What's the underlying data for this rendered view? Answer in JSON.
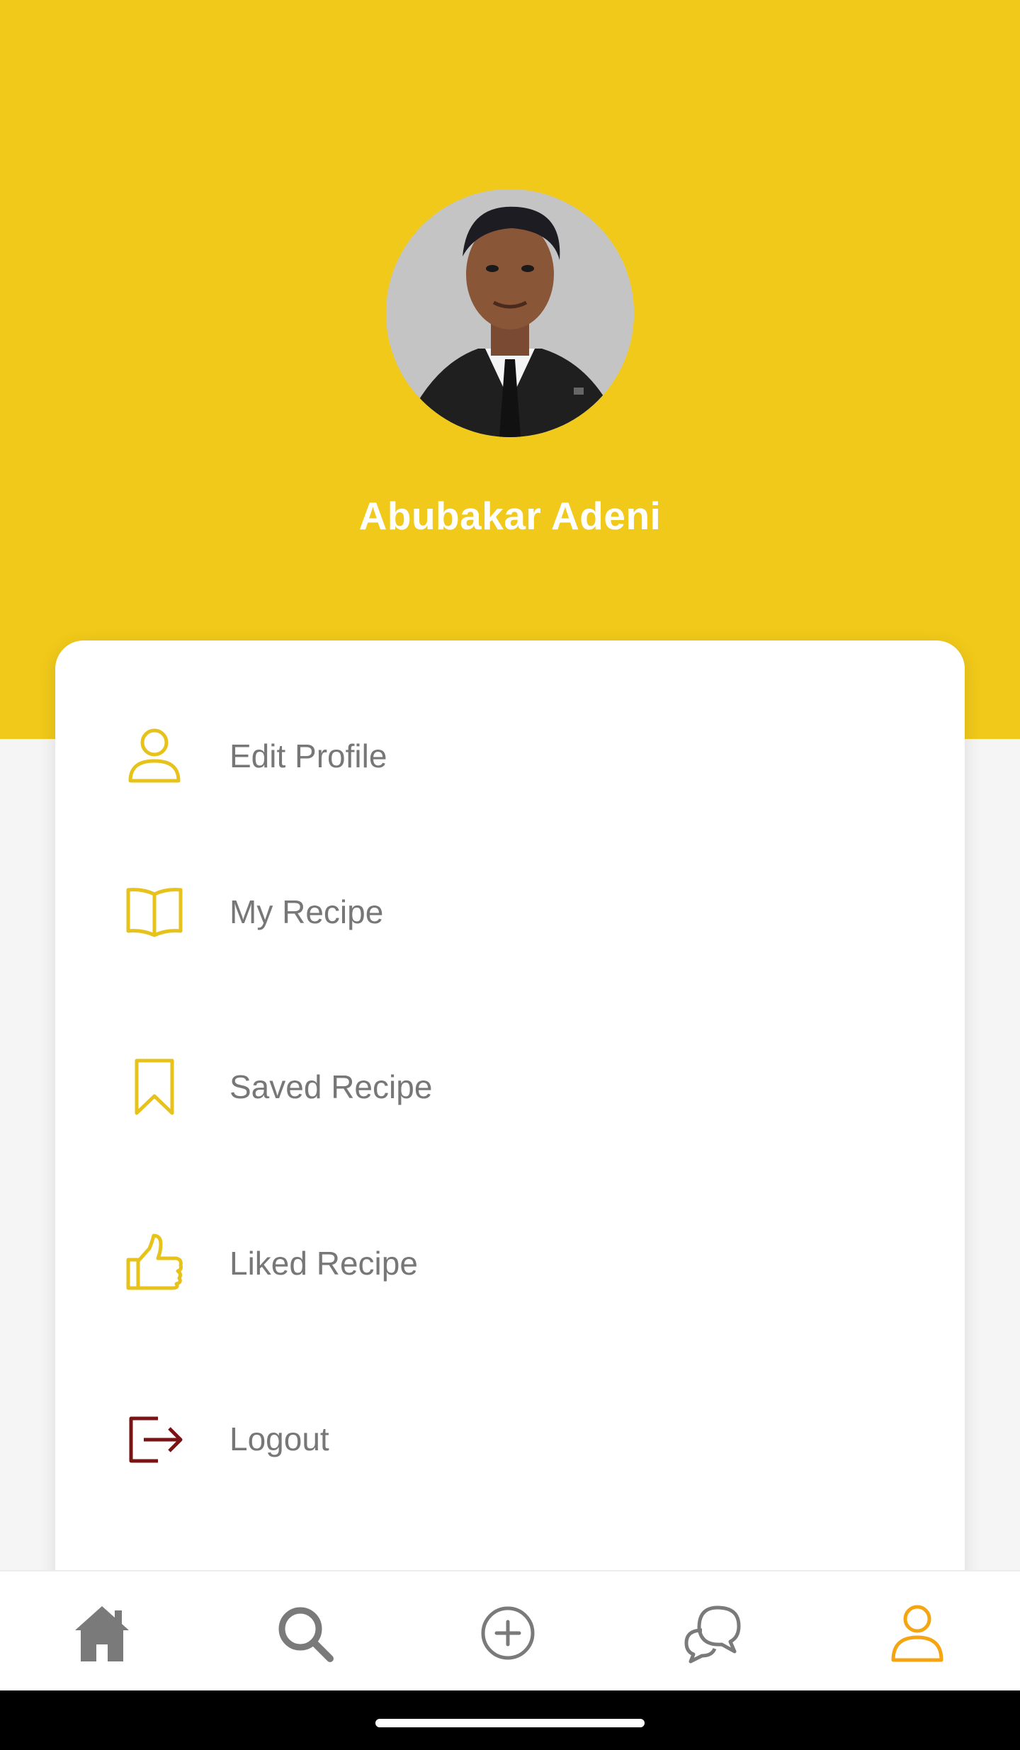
{
  "profile": {
    "name": "Abubakar Adeni",
    "avatar_alt": "profile-photo"
  },
  "colors": {
    "brand_yellow": "#f0c91a",
    "menu_icon": "#e6c21a",
    "logout_icon": "#7a1414",
    "nav_inactive": "#7a7a7a",
    "nav_active": "#f5a511"
  },
  "menu": {
    "items": [
      {
        "label": "Edit Profile",
        "icon": "person-icon"
      },
      {
        "label": "My Recipe",
        "icon": "open-book-icon"
      },
      {
        "label": "Saved Recipe",
        "icon": "bookmark-icon"
      },
      {
        "label": "Liked Recipe",
        "icon": "thumbs-up-icon"
      },
      {
        "label": "Logout",
        "icon": "logout-icon"
      }
    ]
  },
  "bottom_nav": {
    "items": [
      {
        "name": "home",
        "icon": "home-icon",
        "active": false
      },
      {
        "name": "search",
        "icon": "search-icon",
        "active": false
      },
      {
        "name": "add",
        "icon": "add-circle-icon",
        "active": false
      },
      {
        "name": "chat",
        "icon": "chat-bubbles-icon",
        "active": false
      },
      {
        "name": "profile",
        "icon": "person-icon",
        "active": true
      }
    ]
  }
}
